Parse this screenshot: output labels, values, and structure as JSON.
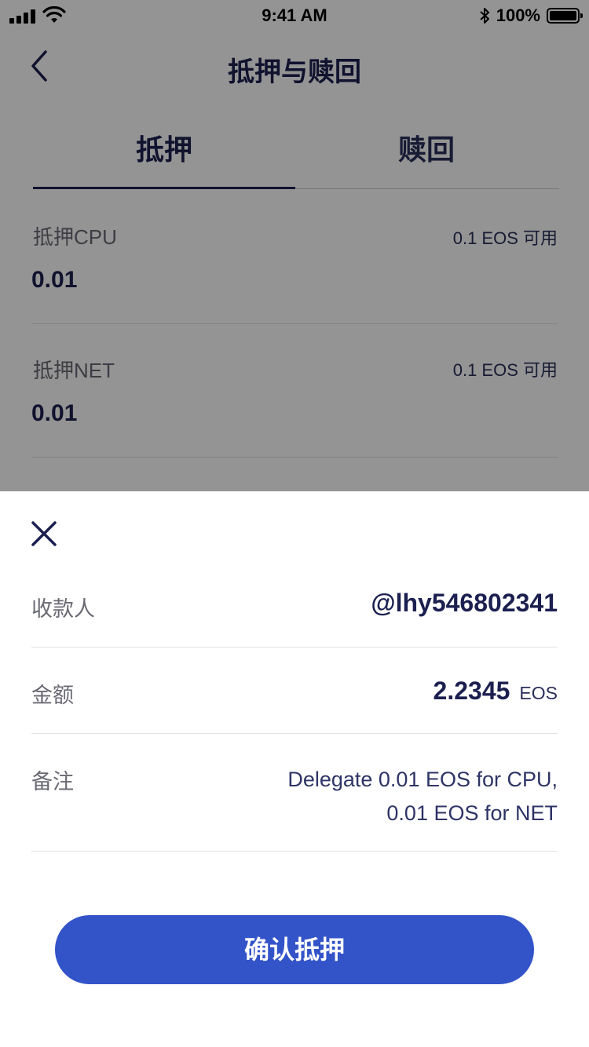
{
  "status_bar": {
    "time": "9:41 AM",
    "battery": "100%"
  },
  "nav": {
    "title": "抵押与赎回"
  },
  "tabs": [
    {
      "label": "抵押",
      "active": true
    },
    {
      "label": "赎回",
      "active": false
    }
  ],
  "fields": [
    {
      "label": "抵押CPU",
      "available": "0.1 EOS 可用",
      "value": "0.01"
    },
    {
      "label": "抵押NET",
      "available": "0.1 EOS 可用",
      "value": "0.01"
    }
  ],
  "sheet": {
    "payee_label": "收款人",
    "payee_value": "@lhy546802341",
    "amount_label": "金额",
    "amount_value": "2.2345",
    "amount_unit": "EOS",
    "memo_label": "备注",
    "memo_line1": "Delegate 0.01 EOS for CPU,",
    "memo_line2": "0.01 EOS for NET",
    "confirm_label": "确认抵押"
  },
  "colors": {
    "accent": "#3353c9",
    "text_primary": "#1c2050",
    "overlay": "#000000"
  }
}
